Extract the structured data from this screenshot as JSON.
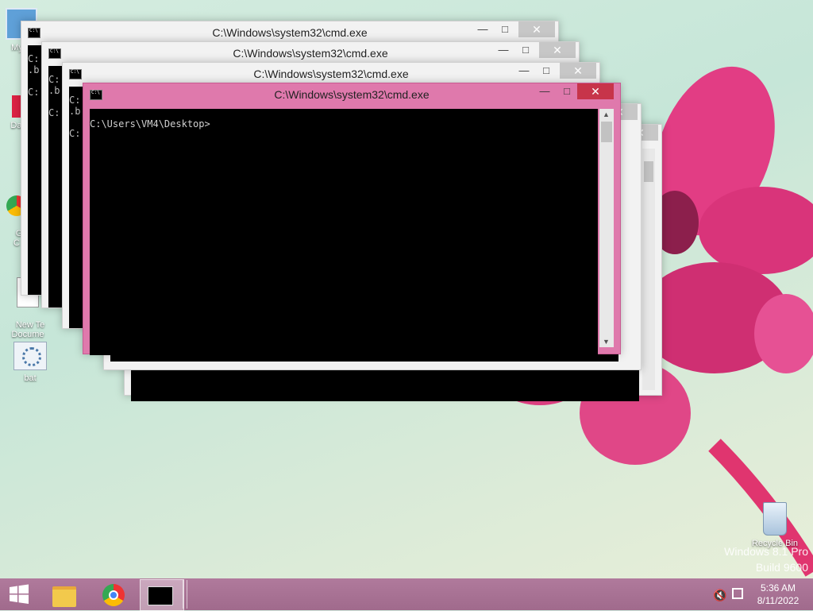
{
  "desktop": {
    "icons": [
      {
        "label": "My C"
      },
      {
        "label": "Data"
      },
      {
        "label": "G\nC"
      },
      {
        "label": "New Te\nDocume"
      },
      {
        "label": "bat"
      },
      {
        "label": "Recycle Bin"
      }
    ],
    "watermark_line1": "Windows 8.1 Pro",
    "watermark_line2": "Build 9600"
  },
  "windows": [
    {
      "title": "C:\\Windows\\system32\\cmd.exe",
      "lines": "C:\n.b\n\nC:"
    },
    {
      "title": "C:\\Windows\\system32\\cmd.exe",
      "lines": "C:\n.b\n\nC:"
    },
    {
      "title": "C:\\Windows\\system32\\cmd.exe",
      "lines": "C:\n.b\n\nC:"
    },
    {
      "title": "C:\\Windows\\system32\\cmd.exe",
      "lines": "C:\\Users\\VM4\\Desktop>"
    },
    {
      "title": "",
      "lines": "bat"
    }
  ],
  "window_controls": {
    "minimize": "—",
    "maximize": "□",
    "close": "✕"
  },
  "taskbar": {
    "clock_time": "5:36 AM",
    "clock_date": "8/11/2022",
    "items": [
      "start",
      "file-explorer",
      "chrome",
      "cmd"
    ]
  },
  "colors": {
    "active_frame": "#df79ac",
    "close_active": "#c7344a",
    "taskbar": "#a8729a"
  }
}
